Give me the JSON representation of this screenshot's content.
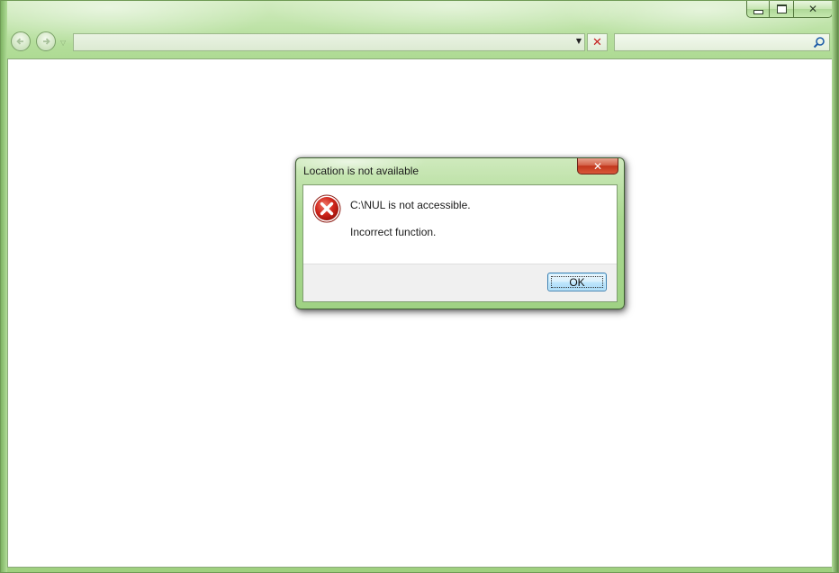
{
  "window": {
    "caption": {
      "minimize_symbol": "",
      "maximize_symbol": "",
      "close_symbol": "✕"
    },
    "nav": {
      "back_icon": "back-arrow-icon",
      "forward_icon": "forward-arrow-icon",
      "recent_pages_symbol": "▽"
    },
    "address_bar": {
      "value": "",
      "dropdown_symbol": "▼",
      "stop_symbol": "✕"
    },
    "search": {
      "value": "",
      "icon": "search-icon"
    }
  },
  "dialog": {
    "title": "Location is not available",
    "close_symbol": "✕",
    "icon": "error-icon",
    "message": "C:\\NUL is not accessible.",
    "detail": "Incorrect function.",
    "ok_label": "OK"
  },
  "colors": {
    "frame_green": "#a9d88d",
    "error_red": "#c41e1e",
    "close_red": "#c2361c",
    "ok_border": "#3c7fb1"
  }
}
